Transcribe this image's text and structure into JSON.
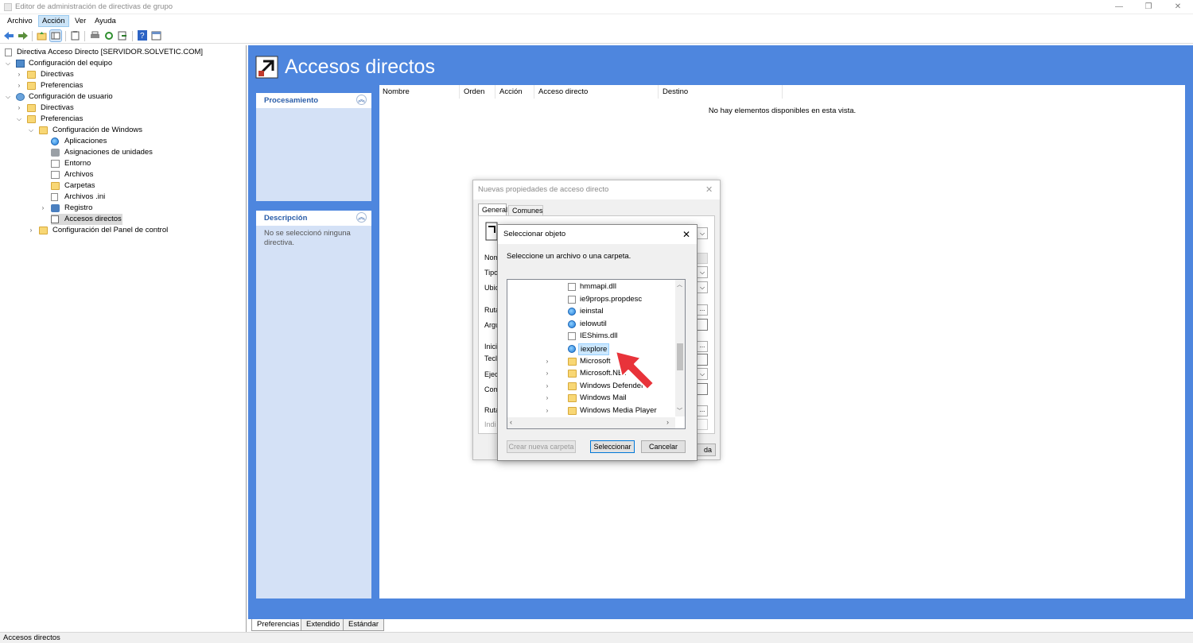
{
  "window": {
    "title": "Editor de administración de directivas de grupo",
    "min": "—",
    "restore": "❐",
    "close": "✕"
  },
  "menu": [
    "Archivo",
    "Acción",
    "Ver",
    "Ayuda"
  ],
  "toolbar": {
    "icons": [
      "back-arrow-icon",
      "forward-arrow-icon",
      "up-folder-icon",
      "show-hide-tree-icon",
      "clipboard-icon",
      "print-icon",
      "refresh-icon",
      "export-list-icon",
      "help-icon",
      "properties-icon"
    ]
  },
  "tree": {
    "root": "Directiva Acceso Directo [SERVIDOR.SOLVETIC.COM]",
    "computer": "Configuración del equipo",
    "computer_children": [
      "Directivas",
      "Preferencias"
    ],
    "user": "Configuración de usuario",
    "user_policies": "Directivas",
    "user_prefs": "Preferencias",
    "windows_settings": "Configuración de Windows",
    "windows_items": [
      "Aplicaciones",
      "Asignaciones de unidades",
      "Entorno",
      "Archivos",
      "Carpetas",
      "Archivos .ini",
      "Registro",
      "Accesos directos"
    ],
    "control_panel": "Configuración del Panel de control"
  },
  "main": {
    "title": "Accesos directos",
    "processing_title": "Procesamiento",
    "description_title": "Descripción",
    "description_text": "No se seleccionó ninguna directiva.",
    "columns": [
      "Nombre",
      "Orden",
      "Acción",
      "Acceso directo",
      "Destino"
    ],
    "empty_text": "No hay elementos disponibles en esta vista."
  },
  "bottom_tabs": [
    "Preferencias",
    "Extendido",
    "Estándar"
  ],
  "status": "Accesos directos",
  "dlg_props": {
    "title": "Nuevas propiedades de acceso directo",
    "tabs": [
      "General",
      "Comunes"
    ],
    "labels": [
      "Nom",
      "Tipo",
      "Ubic",
      "Ruta",
      "Argu",
      "Inici",
      "Tecl",
      "Ejec",
      "Com",
      "Ruta",
      "Indi"
    ],
    "partial_button": "da"
  },
  "dlg_select": {
    "title": "Seleccionar objeto",
    "instruction": "Seleccione un archivo o una carpeta.",
    "files": [
      {
        "name": "hmmapi.dll",
        "icon": "dll-file-icon",
        "folder": false
      },
      {
        "name": "ie9props.propdesc",
        "icon": "document-icon",
        "folder": false
      },
      {
        "name": "ieinstal",
        "icon": "internet-explorer-icon",
        "folder": false
      },
      {
        "name": "ielowutil",
        "icon": "internet-explorer-icon",
        "folder": false
      },
      {
        "name": "IEShims.dll",
        "icon": "dll-file-icon",
        "folder": false
      },
      {
        "name": "iexplore",
        "icon": "internet-explorer-icon",
        "folder": false,
        "selected": true
      },
      {
        "name": "Microsoft",
        "icon": "folder-icon",
        "folder": true
      },
      {
        "name": "Microsoft.NET",
        "icon": "folder-icon",
        "folder": true
      },
      {
        "name": "Windows Defender",
        "icon": "folder-icon",
        "folder": true
      },
      {
        "name": "Windows Mail",
        "icon": "folder-icon",
        "folder": true
      },
      {
        "name": "Windows Media Player",
        "icon": "folder-icon",
        "folder": true
      }
    ],
    "new_folder": "Crear nueva carpeta",
    "select": "Seleccionar",
    "cancel": "Cancelar"
  },
  "colors": {
    "accent": "#4e86de",
    "panel": "#d4e1f6",
    "arrow": "#e8333a",
    "selection": "#cce8ff"
  }
}
